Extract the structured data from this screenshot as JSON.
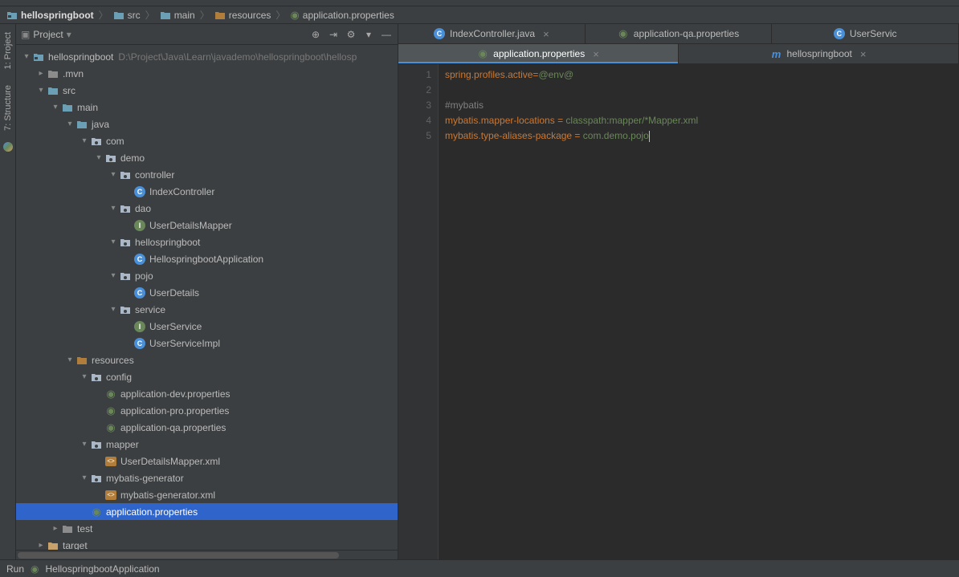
{
  "breadcrumb": [
    {
      "label": "hellospringboot",
      "bold": true,
      "icon": "module"
    },
    {
      "label": "src",
      "icon": "folder-blue"
    },
    {
      "label": "main",
      "icon": "folder-blue"
    },
    {
      "label": "resources",
      "icon": "folder-res"
    },
    {
      "label": "application.properties",
      "icon": "props"
    }
  ],
  "leftrail": {
    "tab1": "1: Project",
    "tab2": "7: Structure"
  },
  "projHeader": {
    "title": "Project"
  },
  "tree": [
    {
      "d": 0,
      "arrow": "v",
      "icon": "module",
      "label": "hellospringboot",
      "path": "D:\\Project\\Java\\Learn\\javademo\\hellospringboot\\hellosp"
    },
    {
      "d": 1,
      "arrow": ">",
      "icon": "folder",
      "label": ".mvn"
    },
    {
      "d": 1,
      "arrow": "v",
      "icon": "folder-blue",
      "label": "src"
    },
    {
      "d": 2,
      "arrow": "v",
      "icon": "folder-blue",
      "label": "main"
    },
    {
      "d": 3,
      "arrow": "v",
      "icon": "folder-blue",
      "label": "java"
    },
    {
      "d": 4,
      "arrow": "v",
      "icon": "pkg",
      "label": "com"
    },
    {
      "d": 5,
      "arrow": "v",
      "icon": "pkg",
      "label": "demo"
    },
    {
      "d": 6,
      "arrow": "v",
      "icon": "pkg",
      "label": "controller"
    },
    {
      "d": 7,
      "arrow": "",
      "icon": "class-c",
      "label": "IndexController"
    },
    {
      "d": 6,
      "arrow": "v",
      "icon": "pkg",
      "label": "dao"
    },
    {
      "d": 7,
      "arrow": "",
      "icon": "class-i",
      "label": "UserDetailsMapper"
    },
    {
      "d": 6,
      "arrow": "v",
      "icon": "pkg",
      "label": "hellospringboot"
    },
    {
      "d": 7,
      "arrow": "",
      "icon": "class-c",
      "label": "HellospringbootApplication"
    },
    {
      "d": 6,
      "arrow": "v",
      "icon": "pkg",
      "label": "pojo"
    },
    {
      "d": 7,
      "arrow": "",
      "icon": "class-c",
      "label": "UserDetails"
    },
    {
      "d": 6,
      "arrow": "v",
      "icon": "pkg",
      "label": "service"
    },
    {
      "d": 7,
      "arrow": "",
      "icon": "class-i",
      "label": "UserService"
    },
    {
      "d": 7,
      "arrow": "",
      "icon": "class-c",
      "label": "UserServiceImpl"
    },
    {
      "d": 3,
      "arrow": "v",
      "icon": "folder-res",
      "label": "resources"
    },
    {
      "d": 4,
      "arrow": "v",
      "icon": "pkg",
      "label": "config"
    },
    {
      "d": 5,
      "arrow": "",
      "icon": "props",
      "label": "application-dev.properties"
    },
    {
      "d": 5,
      "arrow": "",
      "icon": "props",
      "label": "application-pro.properties"
    },
    {
      "d": 5,
      "arrow": "",
      "icon": "props",
      "label": "application-qa.properties"
    },
    {
      "d": 4,
      "arrow": "v",
      "icon": "pkg",
      "label": "mapper"
    },
    {
      "d": 5,
      "arrow": "",
      "icon": "xml",
      "label": "UserDetailsMapper.xml"
    },
    {
      "d": 4,
      "arrow": "v",
      "icon": "pkg",
      "label": "mybatis-generator"
    },
    {
      "d": 5,
      "arrow": "",
      "icon": "xml",
      "label": "mybatis-generator.xml"
    },
    {
      "d": 4,
      "arrow": "",
      "icon": "props",
      "label": "application.properties",
      "selected": true
    },
    {
      "d": 2,
      "arrow": ">",
      "icon": "folder",
      "label": "test"
    },
    {
      "d": 1,
      "arrow": ">",
      "icon": "folder-orange",
      "label": "target"
    }
  ],
  "tabsRow1": [
    {
      "label": "IndexController.java",
      "icon": "class-c",
      "close": true
    },
    {
      "label": "application-qa.properties",
      "icon": "props",
      "close": false
    },
    {
      "label": "UserServic",
      "icon": "class-c",
      "close": false
    }
  ],
  "tabsRow2": [
    {
      "label": "application.properties",
      "icon": "props",
      "active": true,
      "close": true
    },
    {
      "label": "hellospringboot",
      "icon": "maven",
      "close": true
    }
  ],
  "code": {
    "lines": [
      {
        "n": 1,
        "segs": [
          {
            "t": "spring",
            "c": "tok-key"
          },
          {
            "t": ".",
            "c": "tok-dot"
          },
          {
            "t": "profiles",
            "c": "tok-key"
          },
          {
            "t": ".",
            "c": "tok-dot"
          },
          {
            "t": "active",
            "c": "tok-key"
          },
          {
            "t": "=",
            "c": "tok-op"
          },
          {
            "t": "@env@",
            "c": "tok-green"
          }
        ]
      },
      {
        "n": 2,
        "segs": []
      },
      {
        "n": 3,
        "segs": [
          {
            "t": "#mybatis",
            "c": "tok-comment"
          }
        ]
      },
      {
        "n": 4,
        "segs": [
          {
            "t": "mybatis",
            "c": "tok-key"
          },
          {
            "t": ".",
            "c": "tok-dot"
          },
          {
            "t": "mapper-locations",
            "c": "tok-key"
          },
          {
            "t": " = ",
            "c": "tok-op"
          },
          {
            "t": "classpath",
            "c": "tok-green"
          },
          {
            "t": ":",
            "c": "tok-dot"
          },
          {
            "t": "mapper/*Mapper",
            "c": "tok-green"
          },
          {
            "t": ".",
            "c": "tok-dot"
          },
          {
            "t": "xml",
            "c": "tok-green"
          }
        ]
      },
      {
        "n": 5,
        "segs": [
          {
            "t": "mybatis",
            "c": "tok-key"
          },
          {
            "t": ".",
            "c": "tok-dot"
          },
          {
            "t": "type-aliases-package",
            "c": "tok-key"
          },
          {
            "t": " = ",
            "c": "tok-op"
          },
          {
            "t": "com",
            "c": "tok-green"
          },
          {
            "t": ".",
            "c": "tok-dot"
          },
          {
            "t": "demo",
            "c": "tok-green"
          },
          {
            "t": ".",
            "c": "tok-dot"
          },
          {
            "t": "pojo",
            "c": "tok-green"
          }
        ],
        "caret": true
      }
    ]
  },
  "statusbar": {
    "run": "Run",
    "app": "HellospringbootApplication"
  }
}
